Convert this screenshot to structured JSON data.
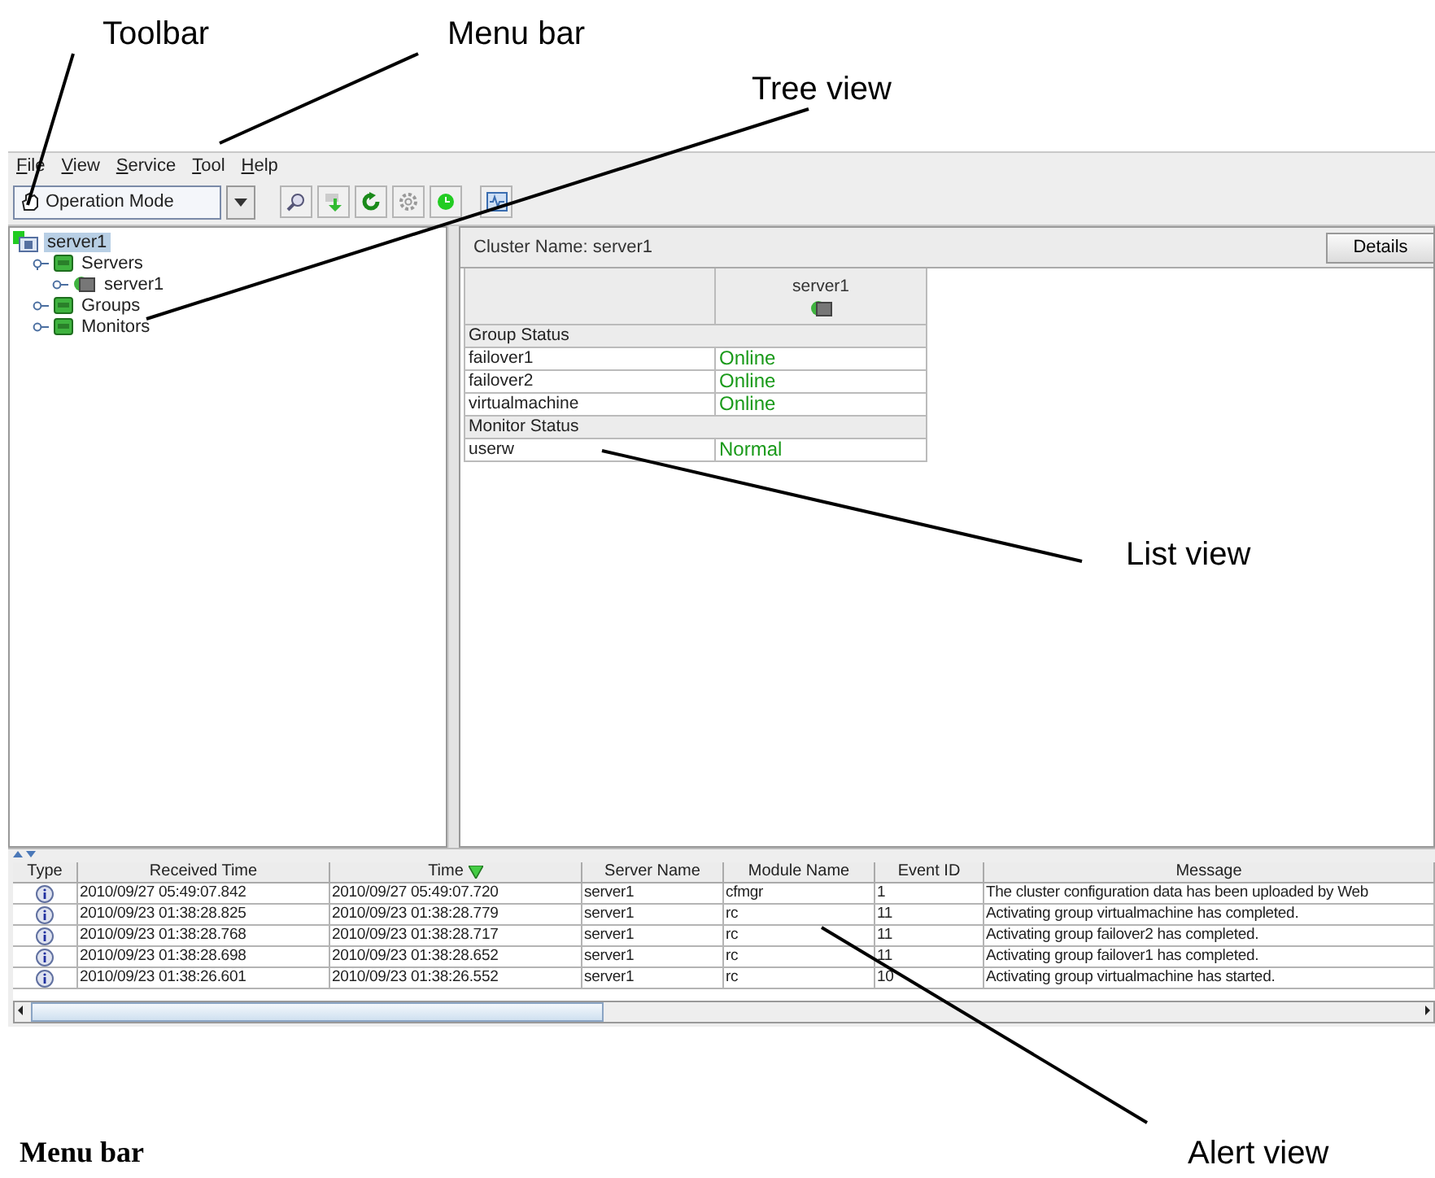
{
  "callouts": [
    {
      "label": "Toolbar"
    },
    {
      "label": "Menu bar"
    },
    {
      "label": "Tree view"
    },
    {
      "label": "List view"
    },
    {
      "label": "Alert view"
    }
  ],
  "menu_bar": {
    "items": [
      "File",
      "View",
      "Service",
      "Tool",
      "Help"
    ]
  },
  "toolbar": {
    "mode_select": {
      "value": "Operation Mode"
    }
  },
  "tree": {
    "items": [
      {
        "label": "server1",
        "kind": "cluster",
        "selected": true,
        "children": [
          {
            "label": "Servers",
            "kind": "folder",
            "selected": false,
            "expanded": true,
            "children": [
              {
                "label": "server1",
                "kind": "server",
                "selected": false,
                "expanded": false
              }
            ]
          },
          {
            "label": "Groups",
            "kind": "folder",
            "selected": false,
            "expanded": false
          },
          {
            "label": "Monitors",
            "kind": "folder",
            "selected": false,
            "expanded": false
          }
        ]
      }
    ]
  },
  "list_view": {
    "cluster_name": "Cluster Name: server1",
    "details_button": "Details",
    "server_column": "server1",
    "sections": [
      {
        "title": "Group Status",
        "rows": [
          {
            "name": "failover1",
            "status": "Online"
          },
          {
            "name": "failover2",
            "status": "Online"
          },
          {
            "name": "virtualmachine",
            "status": "Online"
          }
        ]
      },
      {
        "title": "Monitor Status",
        "rows": [
          {
            "name": "userw",
            "status": "Normal"
          }
        ]
      }
    ]
  },
  "alert_view": {
    "columns": [
      {
        "label": "Type",
        "sorted": false
      },
      {
        "label": "Received Time",
        "sorted": false
      },
      {
        "label": "Time",
        "sorted": true
      },
      {
        "label": "Server Name",
        "sorted": false
      },
      {
        "label": "Module Name",
        "sorted": false
      },
      {
        "label": "Event ID",
        "sorted": false
      },
      {
        "label": "Message",
        "sorted": false
      }
    ],
    "rows": [
      {
        "kind": "info",
        "received": "2010/09/27 05:49:07.842",
        "time": "2010/09/27 05:49:07.720",
        "server": "server1",
        "module": "cfmgr",
        "event_id": "1",
        "message": "The cluster configuration data has been uploaded by Web"
      },
      {
        "kind": "info",
        "received": "2010/09/23 01:38:28.825",
        "time": "2010/09/23 01:38:28.779",
        "server": "server1",
        "module": "rc",
        "event_id": "11",
        "message": "Activating group virtualmachine has completed."
      },
      {
        "kind": "info",
        "received": "2010/09/23 01:38:28.768",
        "time": "2010/09/23 01:38:28.717",
        "server": "server1",
        "module": "rc",
        "event_id": "11",
        "message": "Activating group failover2 has completed."
      },
      {
        "kind": "info",
        "received": "2010/09/23 01:38:28.698",
        "time": "2010/09/23 01:38:28.652",
        "server": "server1",
        "module": "rc",
        "event_id": "11",
        "message": "Activating group failover1 has completed."
      },
      {
        "kind": "info",
        "received": "2010/09/23 01:38:26.601",
        "time": "2010/09/23 01:38:26.552",
        "server": "server1",
        "module": "rc",
        "event_id": "10",
        "message": "Activating group virtualmachine has started."
      }
    ]
  },
  "section_heading": "Menu bar"
}
